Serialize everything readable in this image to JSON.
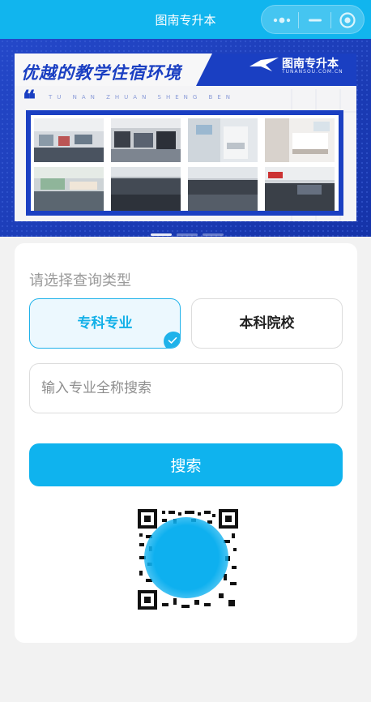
{
  "navbar": {
    "title": "图南专升本",
    "capsule": {
      "more_icon": "more-dots-icon",
      "minimize_icon": "minimize-icon",
      "close_icon": "target-close-icon"
    },
    "color": "#11b5ee"
  },
  "banner": {
    "title": "优越的教学住宿环境",
    "brand_name": "图南专升本",
    "brand_domain": "TUNANSOU.COM.CN",
    "pinyin": "TU NAN ZHUAN SHENG BEN",
    "quote_mark": "❝",
    "photos": [
      {
        "label": "classroom-1"
      },
      {
        "label": "classroom-2"
      },
      {
        "label": "dorm-room-1"
      },
      {
        "label": "dorm-room-2"
      },
      {
        "label": "lecture-hall-1"
      },
      {
        "label": "classroom-3"
      },
      {
        "label": "lecture-hall-2"
      },
      {
        "label": "classroom-4"
      }
    ],
    "carousel_count": 3,
    "carousel_active_index": 0
  },
  "query": {
    "label": "请选择查询类型",
    "options": [
      {
        "label": "专科专业",
        "selected": true
      },
      {
        "label": "本科院校",
        "selected": false
      }
    ],
    "search_input": {
      "placeholder": "输入专业全称搜索",
      "value": ""
    },
    "search_button": "搜索",
    "qr_icon": "qr-code-icon",
    "accent_color": "#0fb3ee"
  }
}
